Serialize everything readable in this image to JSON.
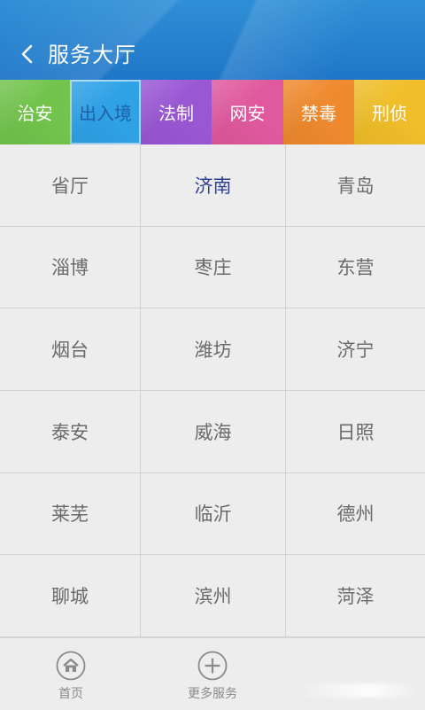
{
  "header": {
    "title": "服务大厅",
    "back_icon": "chevron-left-icon",
    "background": "#2a86d2"
  },
  "tabs": [
    {
      "label": "治安",
      "color": "#6cc24a",
      "selected": false
    },
    {
      "label": "出入境",
      "color": "#34a7e7",
      "selected": true
    },
    {
      "label": "法制",
      "color": "#9b55d6",
      "selected": false
    },
    {
      "label": "网安",
      "color": "#e05a9d",
      "selected": false
    },
    {
      "label": "禁毒",
      "color": "#f08a2f",
      "selected": false
    },
    {
      "label": "刑侦",
      "color": "#f1bf2a",
      "selected": false
    }
  ],
  "grid": {
    "items": [
      {
        "label": "省厅"
      },
      {
        "label": "济南",
        "active": true
      },
      {
        "label": "青岛"
      },
      {
        "label": "淄博"
      },
      {
        "label": "枣庄"
      },
      {
        "label": "东营"
      },
      {
        "label": "烟台"
      },
      {
        "label": "潍坊"
      },
      {
        "label": "济宁"
      },
      {
        "label": "泰安"
      },
      {
        "label": "威海"
      },
      {
        "label": "日照"
      },
      {
        "label": "莱芜"
      },
      {
        "label": "临沂"
      },
      {
        "label": "德州"
      },
      {
        "label": "聊城"
      },
      {
        "label": "滨州"
      },
      {
        "label": "菏泽"
      }
    ]
  },
  "bottom_nav": [
    {
      "label": "首页",
      "icon": "home-icon"
    },
    {
      "label": "更多服务",
      "icon": "plus-circle-icon"
    }
  ]
}
